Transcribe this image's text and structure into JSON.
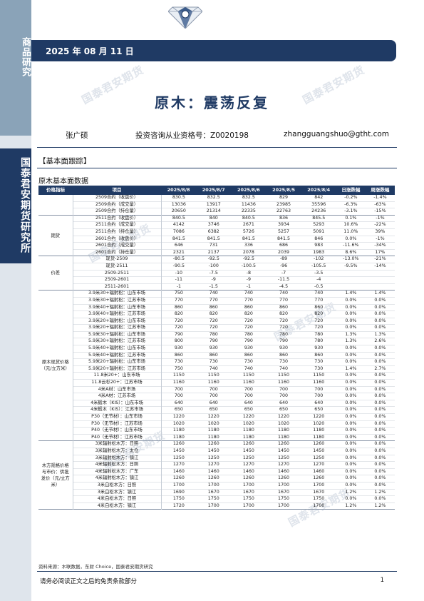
{
  "sidebar": {
    "category": "商品研究",
    "org": "国泰君安期货研究所"
  },
  "header": {
    "date": "2025 年 08 月 11 日"
  },
  "title": "原木：震荡反复",
  "author": {
    "name": "张广硕",
    "license": "投资咨询从业资格号：Z0020198",
    "email": "zhangguangshuo@gtht.com"
  },
  "section": "【基本面跟踪】",
  "table_title": "原木基本面数据",
  "watermark": "国泰君安期货",
  "columns": [
    "价格指标",
    "项目",
    "2025/8/8",
    "2025/8/7",
    "2025/8/6",
    "2025/8/5",
    "2025/8/4",
    "日涨跌幅",
    "周涨跌幅"
  ],
  "groups": [
    {
      "name": "",
      "rows": [
        [
          "2509合约（收盘价）",
          "830.5",
          "832.5",
          "832.5",
          "829",
          "842",
          "-0.2%",
          "-1.4%"
        ],
        [
          "2509合约（成交量）",
          "13036",
          "13917",
          "11436",
          "23985",
          "35596",
          "-6.3%",
          "-63%"
        ],
        [
          "2509合约（持仓量）",
          "20650",
          "21314",
          "22335",
          "22763",
          "24236",
          "-3.1%",
          "-15%"
        ]
      ]
    },
    {
      "name": "期货",
      "rows": [
        [
          "2511合约（收盘价）",
          "840.5",
          "840",
          "840.5",
          "836",
          "845.5",
          "0.1%",
          "-1%"
        ],
        [
          "2511合约（成交量）",
          "4142",
          "3746",
          "2671",
          "3934",
          "5293",
          "10.6%",
          "-22%"
        ],
        [
          "2511合约（持仓量）",
          "7086",
          "6382",
          "5726",
          "5257",
          "5091",
          "11.0%",
          "39%"
        ],
        [
          "2601合约（收盘价）",
          "841.5",
          "841.5",
          "841.5",
          "841.5",
          "846",
          "0.0%",
          "-1%"
        ],
        [
          "2601合约（成交量）",
          "646",
          "731",
          "336",
          "686",
          "983",
          "-11.6%",
          "-34%"
        ],
        [
          "2601合约（持仓量）",
          "2321",
          "2137",
          "2078",
          "2039",
          "1983",
          "8.6%",
          "17%"
        ]
      ]
    },
    {
      "name": "价差",
      "rows": [
        [
          "现货-2509",
          "-80.5",
          "-92.5",
          "-92.5",
          "-89",
          "-102",
          "-13.0%",
          "-21%"
        ],
        [
          "现货-2511",
          "-90.5",
          "-100",
          "-100.5",
          "-96",
          "-105.5",
          "-9.5%",
          "-14%"
        ],
        [
          "2509-2511",
          "-10",
          "-7.5",
          "-8",
          "-7",
          "-3.5",
          "",
          ""
        ],
        [
          "2509-2601",
          "-11",
          "-9",
          "-9",
          "-11.5",
          "-4",
          "",
          ""
        ],
        [
          "2511-2601",
          "-1",
          "-1.5",
          "-1",
          "-4.5",
          "-0.5",
          "",
          ""
        ]
      ]
    },
    {
      "name": "原木现货价格（元/立方米）",
      "rows": [
        [
          "3.9米30+辐射松：山东市场",
          "750",
          "740",
          "740",
          "740",
          "740",
          "1.4%",
          "1.4%"
        ],
        [
          "3.9米30+辐射松：江苏市场",
          "770",
          "770",
          "770",
          "770",
          "770",
          "0.0%",
          "0.0%"
        ],
        [
          "3.9米40+辐射松：山东市场",
          "860",
          "860",
          "860",
          "860",
          "860",
          "0.0%",
          "0.0%"
        ],
        [
          "3.9米40+辐射松：江苏市场",
          "820",
          "820",
          "820",
          "820",
          "820",
          "0.0%",
          "0.0%"
        ],
        [
          "3.9米20+辐射松：山东市场",
          "720",
          "720",
          "720",
          "720",
          "720",
          "0.0%",
          "0.0%"
        ],
        [
          "3.9米20+辐射松：江苏市场",
          "720",
          "720",
          "720",
          "720",
          "720",
          "0.0%",
          "0.0%"
        ],
        [
          "5.9米30+辐射松：山东市场",
          "790",
          "780",
          "780",
          "780",
          "780",
          "1.3%",
          "1.3%"
        ],
        [
          "5.9米30+辐射松：江苏市场",
          "800",
          "790",
          "790",
          "790",
          "780",
          "1.3%",
          "2.6%"
        ],
        [
          "5.9米40+辐射松：山东市场",
          "930",
          "930",
          "930",
          "930",
          "930",
          "0.0%",
          "0.0%"
        ],
        [
          "5.9米40+辐射松：江苏市场",
          "860",
          "860",
          "860",
          "860",
          "860",
          "0.0%",
          "0.0%"
        ],
        [
          "5.9米20+辐射松：山东市场",
          "730",
          "730",
          "730",
          "730",
          "730",
          "0.0%",
          "0.0%"
        ],
        [
          "5.9米20+辐射松：江苏市场",
          "750",
          "740",
          "740",
          "740",
          "730",
          "1.4%",
          "2.7%"
        ],
        [
          "11.8米20+：山东市场",
          "1150",
          "1150",
          "1150",
          "1150",
          "1150",
          "0.0%",
          "0.0%"
        ],
        [
          "11.8云杉20+：江苏市场",
          "1160",
          "1160",
          "1160",
          "1160",
          "1160",
          "0.0%",
          "0.0%"
        ],
        [
          "4米A材：山东市场",
          "700",
          "700",
          "700",
          "700",
          "700",
          "0.0%",
          "0.0%"
        ],
        [
          "4米A材：江苏市场",
          "700",
          "700",
          "700",
          "700",
          "700",
          "0.0%",
          "0.0%"
        ],
        [
          "4米椴木（KIS）：山东市场",
          "640",
          "640",
          "640",
          "640",
          "640",
          "0.0%",
          "0.0%"
        ],
        [
          "4米椴木（KIS）：江苏市场",
          "650",
          "650",
          "650",
          "650",
          "650",
          "0.0%",
          "0.0%"
        ],
        [
          "P30（无节材）：山东市场",
          "1220",
          "1220",
          "1220",
          "1220",
          "1220",
          "0.0%",
          "0.0%"
        ],
        [
          "P30（无节材）：江苏市场",
          "1020",
          "1020",
          "1020",
          "1020",
          "1020",
          "0.0%",
          "0.0%"
        ],
        [
          "P40（无节材）：山东市场",
          "1180",
          "1180",
          "1180",
          "1180",
          "1180",
          "0.0%",
          "0.0%"
        ],
        [
          "P40（无节材）：江苏市场",
          "1180",
          "1180",
          "1180",
          "1180",
          "1180",
          "0.0%",
          "0.0%"
        ]
      ]
    },
    {
      "name": "木方规格价格与市价：供批发价（元/立方米）",
      "rows": [
        [
          "3米辐射松木方：日照",
          "1260",
          "1260",
          "1260",
          "1260",
          "1260",
          "0.0%",
          "0.0%"
        ],
        [
          "3米辐射松木方：太仓",
          "1450",
          "1450",
          "1450",
          "1450",
          "1450",
          "0.0%",
          "0.0%"
        ],
        [
          "3米辐射松木方：镇江",
          "1250",
          "1250",
          "1250",
          "1250",
          "1250",
          "0.0%",
          "0.0%"
        ],
        [
          "4米辐射松木方：日照",
          "1270",
          "1270",
          "1270",
          "1270",
          "1270",
          "0.0%",
          "0.0%"
        ],
        [
          "4米辐射松木方：广东",
          "1460",
          "1460",
          "1460",
          "1460",
          "1460",
          "0.0%",
          "0.0%"
        ],
        [
          "4米辐射松木方：镇江",
          "1260",
          "1260",
          "1260",
          "1260",
          "1260",
          "0.0%",
          "0.0%"
        ],
        [
          "3米白松木方：日照",
          "1700",
          "1700",
          "1700",
          "1700",
          "1700",
          "0.0%",
          "0.0%"
        ],
        [
          "3米白松木方：镇江",
          "1690",
          "1670",
          "1670",
          "1670",
          "1670",
          "1.2%",
          "1.2%"
        ],
        [
          "4米白松木方：日照",
          "1750",
          "1750",
          "1750",
          "1750",
          "1750",
          "0.0%",
          "0.0%"
        ],
        [
          "4米白松木方：镇江",
          "1720",
          "1700",
          "1700",
          "1700",
          "1700",
          "1.2%",
          "1.2%"
        ]
      ]
    }
  ],
  "source": "资料来源：木联数据，东财 Choice，国泰君安期货研究",
  "footer": "请务必阅读正文之后的免责条款部分",
  "page": "1"
}
